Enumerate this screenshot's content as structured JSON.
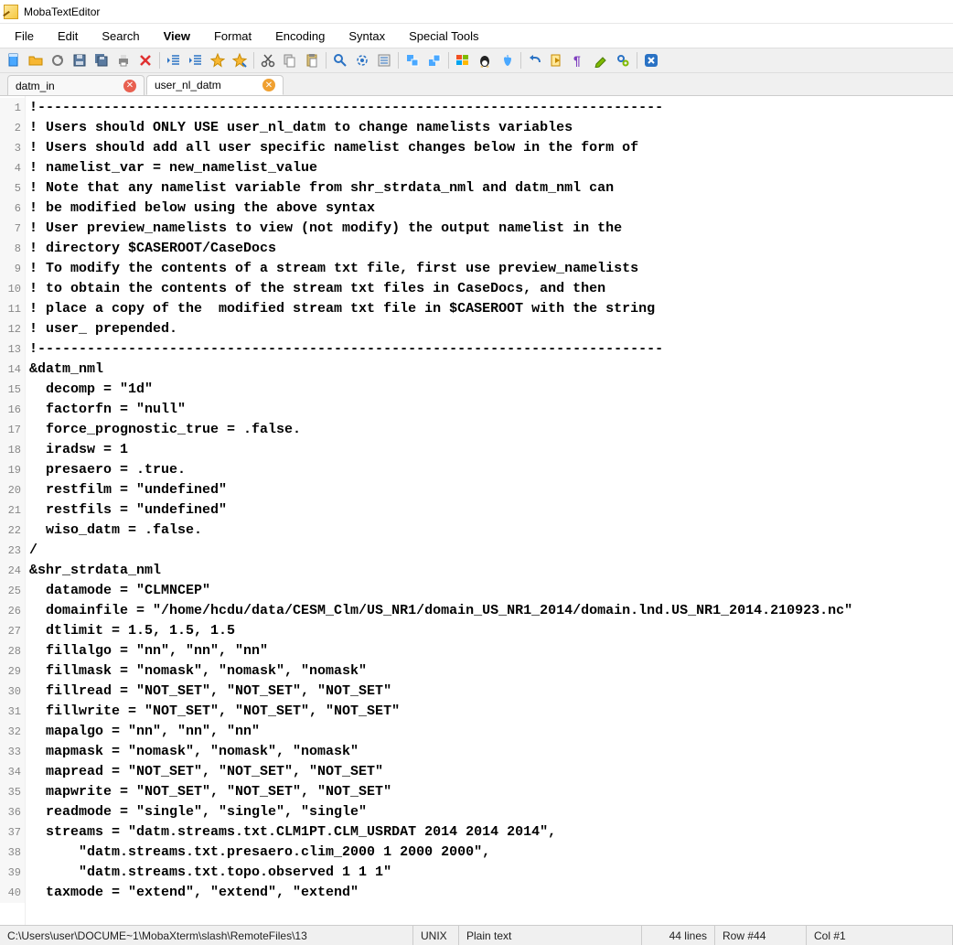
{
  "window": {
    "title": "MobaTextEditor"
  },
  "menu": {
    "items": [
      "File",
      "Edit",
      "Search",
      "View",
      "Format",
      "Encoding",
      "Syntax",
      "Special Tools"
    ],
    "active_index": 3
  },
  "toolbar_icons": [
    "new-file-icon",
    "open-folder-icon",
    "reload-icon",
    "save-icon",
    "save-all-icon",
    "print-icon",
    "close-icon",
    "sep",
    "outdent-icon",
    "indent-icon",
    "bookmark-add-icon",
    "bookmark-next-icon",
    "sep",
    "cut-icon",
    "copy-icon",
    "paste-icon",
    "sep",
    "search-icon",
    "search-loop-icon",
    "list-icon",
    "sep",
    "copy-block-icon",
    "copy-block2-icon",
    "sep",
    "windows-icon",
    "linux-icon",
    "apple-icon",
    "sep",
    "undo-icon",
    "redo-arrow-icon",
    "pilcrow-icon",
    "highlighter-icon",
    "gears-icon",
    "sep",
    "exit-icon"
  ],
  "tabs": [
    {
      "label": "datm_in",
      "active": false,
      "close_style": "red"
    },
    {
      "label": "user_nl_datm",
      "active": true,
      "close_style": "orange"
    }
  ],
  "code_lines": [
    "!----------------------------------------------------------------------------",
    "! Users should ONLY USE user_nl_datm to change namelists variables",
    "! Users should add all user specific namelist changes below in the form of",
    "! namelist_var = new_namelist_value",
    "! Note that any namelist variable from shr_strdata_nml and datm_nml can",
    "! be modified below using the above syntax",
    "! User preview_namelists to view (not modify) the output namelist in the",
    "! directory $CASEROOT/CaseDocs",
    "! To modify the contents of a stream txt file, first use preview_namelists",
    "! to obtain the contents of the stream txt files in CaseDocs, and then",
    "! place a copy of the  modified stream txt file in $CASEROOT with the string",
    "! user_ prepended.",
    "!----------------------------------------------------------------------------",
    "&datm_nml",
    "  decomp = \"1d\"",
    "  factorfn = \"null\"",
    "  force_prognostic_true = .false.",
    "  iradsw = 1",
    "  presaero = .true.",
    "  restfilm = \"undefined\"",
    "  restfils = \"undefined\"",
    "  wiso_datm = .false.",
    "/",
    "&shr_strdata_nml",
    "  datamode = \"CLMNCEP\"",
    "  domainfile = \"/home/hcdu/data/CESM_Clm/US_NR1/domain_US_NR1_2014/domain.lnd.US_NR1_2014.210923.nc\"",
    "  dtlimit = 1.5, 1.5, 1.5",
    "  fillalgo = \"nn\", \"nn\", \"nn\"",
    "  fillmask = \"nomask\", \"nomask\", \"nomask\"",
    "  fillread = \"NOT_SET\", \"NOT_SET\", \"NOT_SET\"",
    "  fillwrite = \"NOT_SET\", \"NOT_SET\", \"NOT_SET\"",
    "  mapalgo = \"nn\", \"nn\", \"nn\"",
    "  mapmask = \"nomask\", \"nomask\", \"nomask\"",
    "  mapread = \"NOT_SET\", \"NOT_SET\", \"NOT_SET\"",
    "  mapwrite = \"NOT_SET\", \"NOT_SET\", \"NOT_SET\"",
    "  readmode = \"single\", \"single\", \"single\"",
    "  streams = \"datm.streams.txt.CLM1PT.CLM_USRDAT 2014 2014 2014\",",
    "      \"datm.streams.txt.presaero.clim_2000 1 2000 2000\",",
    "      \"datm.streams.txt.topo.observed 1 1 1\"",
    "  taxmode = \"extend\", \"extend\", \"extend\""
  ],
  "status": {
    "path": "C:\\Users\\user\\DOCUME~1\\MobaXterm\\slash\\RemoteFiles\\13",
    "line_ending": "UNIX",
    "filetype": "Plain text",
    "lines": "44 lines",
    "row": "Row #44",
    "col": "Col #1"
  }
}
